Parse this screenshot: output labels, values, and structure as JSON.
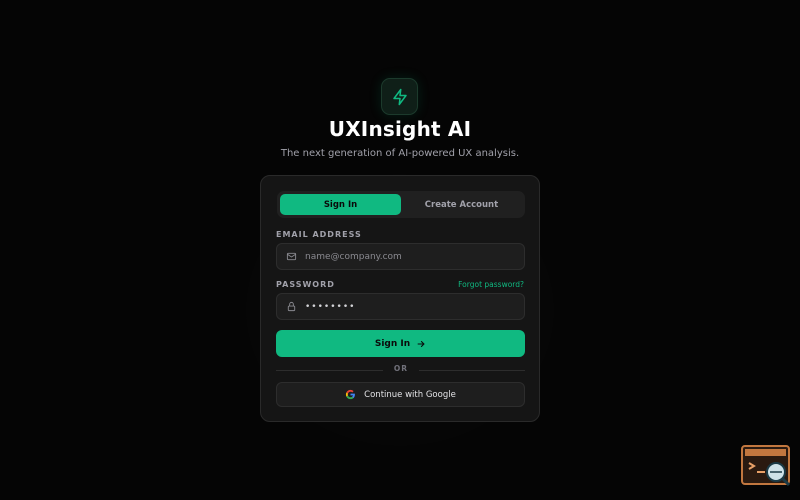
{
  "brand": {
    "name": "UXInsight AI",
    "tagline": "The next generation of AI-powered UX analysis.",
    "logo_icon": "lightning-bolt-icon",
    "accent": "#10b981"
  },
  "tabs": {
    "sign_in": "Sign In",
    "create_account": "Create Account",
    "active": "Sign In"
  },
  "form": {
    "email_label": "EMAIL ADDRESS",
    "email_placeholder": "name@company.com",
    "email_icon": "mail-icon",
    "password_label": "PASSWORD",
    "password_value": "••••••••",
    "password_icon": "lock-icon",
    "forgot_label": "Forgot password?",
    "submit_label": "Sign In",
    "submit_icon": "arrow-right-icon",
    "divider_text": "OR",
    "google_label": "Continue with Google",
    "google_icon": "google-icon"
  },
  "helper_widget": {
    "icon": "terminal-search-icon"
  }
}
